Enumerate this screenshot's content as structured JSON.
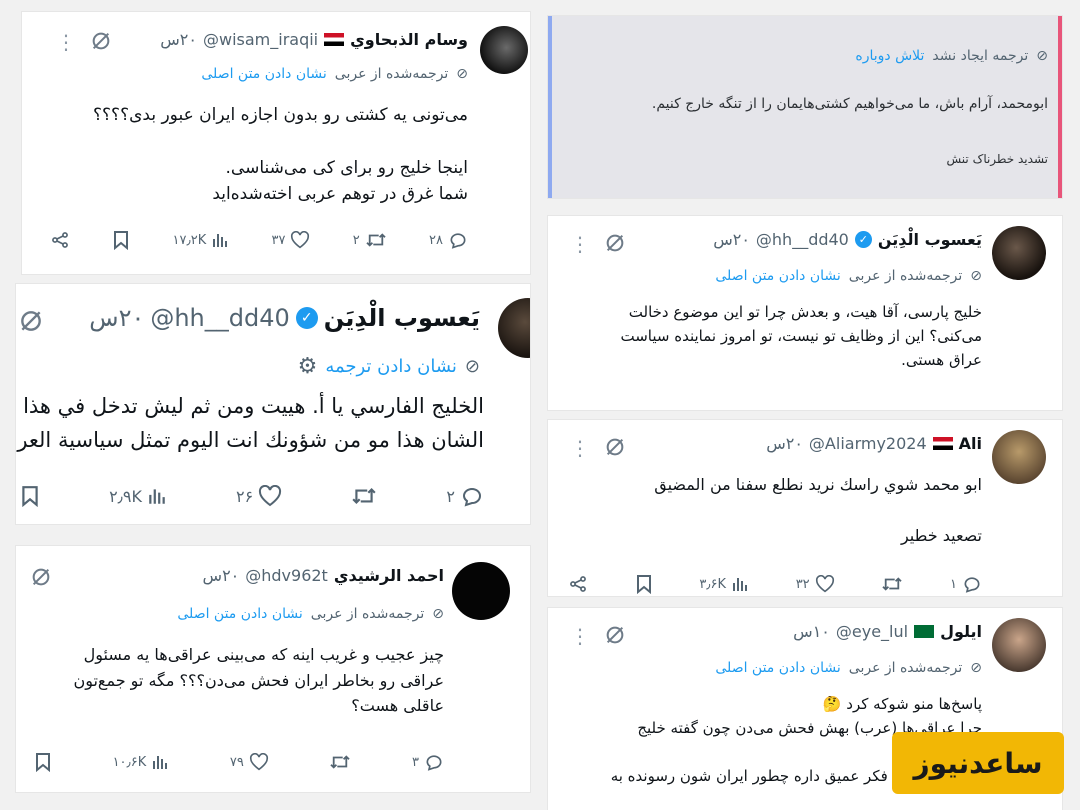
{
  "tweets": {
    "t1": {
      "name": "وسام الذبحاوي",
      "handle": "@wisam_iraqii",
      "time": "۲۰س",
      "translated_from": "ترجمه‌شده از عربی",
      "show_original": "نشان دادن متن اصلی",
      "lines": [
        "می‌تونی یه کشتی رو بدون اجازه ایران عبور بدی؟؟؟؟",
        "",
        "اینجا خلیج رو برای کی می‌شناسی.",
        "شما غرق در توهم عربی اخته‌شده‌اید"
      ],
      "replies": "۲۸",
      "retweets": "۲",
      "likes": "۳۷",
      "views": "۱۷٫۲K"
    },
    "t2": {
      "name": "يَعسوب الْدِيَن",
      "handle": "@hh__dd40",
      "time": "۲۰س",
      "show_translation": "نشان دادن ترجمه",
      "lines": [
        "الخليج الفارسي يا أ. هييت ومن ثم ليش تدخل في هذا",
        "الشان هذا مو من شؤونك انت اليوم تمثل سياسية العراق"
      ],
      "replies": "۲",
      "retweets": "",
      "likes": "۲۶",
      "views": "۲٫۹K"
    },
    "t3": {
      "name": "احمد الرشيدي",
      "handle": "@hdv962t",
      "time": "۲۰س",
      "translated_from": "ترجمه‌شده از عربی",
      "show_original": "نشان دادن متن اصلی",
      "lines": [
        "چیز عجیب و غریب اینه که می‌بینی عراقی‌ها یه مسئول",
        "عراقی رو بخاطر ایران فحش می‌دن؟؟؟ مگه تو جمع‌تون",
        "عاقلی هست؟"
      ],
      "replies": "۳",
      "retweets": "",
      "likes": "۷۹",
      "views": "۱۰٫۶K"
    },
    "t4": {
      "translation_failed": "ترجمه ایجاد نشد",
      "retry": "تلاش دوباره",
      "line": "ابومحمد، آرام باش، ما می‌خواهیم کشتی‌هایمان را از تنگه خارج کنیم.",
      "footer": "تشدید خطرناک تنش"
    },
    "t5": {
      "name": "يَعسوب الْدِيَن",
      "handle": "@hh__dd40",
      "time": "۲۰س",
      "translated_from": "ترجمه‌شده از عربی",
      "show_original": "نشان دادن متن اصلی",
      "lines": [
        "خلیج پارسی، آقا هیت، و بعدش چرا تو این موضوع دخالت",
        "می‌کنی؟ این از وظایف تو نیست، تو امروز نماینده سیاست",
        "عراق هستی."
      ]
    },
    "t6": {
      "name": "Ali",
      "handle": "@Aliarmy2024",
      "time": "۲۰س",
      "lines": [
        "ابو محمد شوي راسك نريد نطلع سفنا من المضيق",
        "",
        "تصعيد خطير"
      ],
      "replies": "۱",
      "retweets": "",
      "likes": "۳۲",
      "views": "۳٫۶K"
    },
    "t7": {
      "name": "ايلول",
      "handle": "@eye_lul",
      "time": "۱۰س",
      "translated_from": "ترجمه‌شده از عربی",
      "show_original": "نشان دادن متن اصلی",
      "lines": [
        "پاسخ‌ها منو شوکه کرد 🤔",
        "چرا عراقی‌ها (عرب) بهش فحش می‌دن چون گفته خلیج",
        "",
        "فارس؟ اون یه فکر عمیق داره چطور ایران شون رسونده به"
      ]
    }
  },
  "watermark": "ساعدنیوز",
  "colors": {
    "link": "#1d9bf0",
    "watermark_bg": "#f2b705",
    "grey": "#536471"
  },
  "icons": [
    "grok-icon",
    "more-icon",
    "reply-icon",
    "retweet-icon",
    "like-icon",
    "views-icon",
    "bookmark-icon",
    "share-icon",
    "translate-icon",
    "settings-icon",
    "verified-icon"
  ]
}
